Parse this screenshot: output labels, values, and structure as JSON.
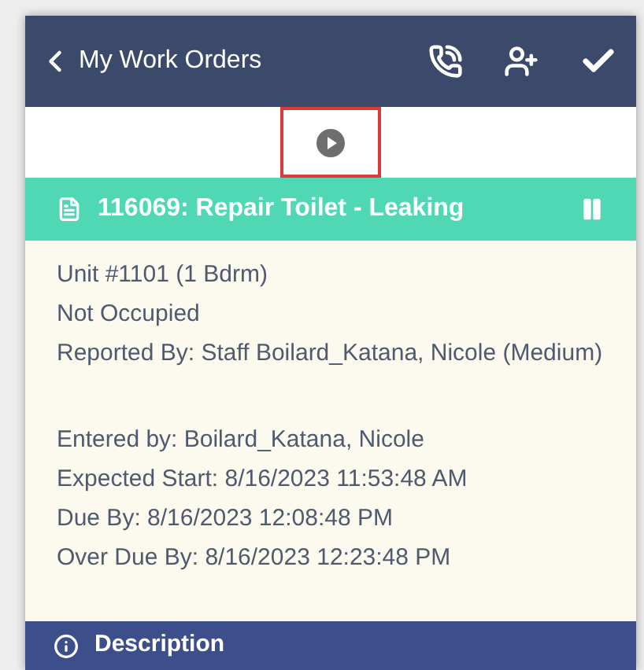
{
  "header": {
    "back_label": "My Work Orders"
  },
  "player": {
    "highlighted": true
  },
  "work_order": {
    "title": "116069: Repair Toilet - Leaking"
  },
  "detail_groups": [
    {
      "lines": [
        "Unit #1101 (1 Bdrm)",
        "Not Occupied",
        "Reported By: Staff Boilard_Katana, Nicole (Medium)"
      ]
    },
    {
      "lines": [
        "Entered by: Boilard_Katana, Nicole",
        "Expected Start: 8/16/2023 11:53:48 AM",
        "Due By: 8/16/2023 12:08:48 PM",
        "Over Due By: 8/16/2023 12:23:48 PM"
      ]
    }
  ],
  "section": {
    "title": "Description"
  }
}
